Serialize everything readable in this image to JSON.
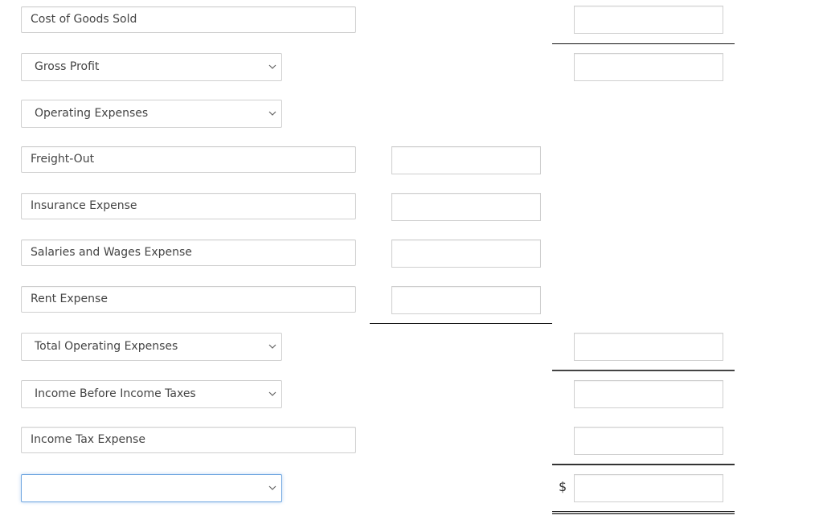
{
  "rows": [
    {
      "label": "Cost of Goods Sold",
      "type": "text"
    },
    {
      "label": "Gross Profit",
      "type": "select"
    },
    {
      "label": "Operating Expenses",
      "type": "select"
    },
    {
      "label": "Freight-Out",
      "type": "text"
    },
    {
      "label": "Insurance Expense",
      "type": "text"
    },
    {
      "label": "Salaries and Wages Expense",
      "type": "text"
    },
    {
      "label": "Rent Expense",
      "type": "text"
    },
    {
      "label": "Total Operating Expenses",
      "type": "select"
    },
    {
      "label": "Income Before Income Taxes",
      "type": "select"
    },
    {
      "label": "Income Tax Expense",
      "type": "text"
    },
    {
      "label": "",
      "type": "select"
    }
  ],
  "currency_symbol": "$",
  "icons": {
    "dropdown": "chevron-down-icon"
  },
  "colors": {
    "focus_border": "#6fa6e0",
    "input_border": "#cfcfcf"
  }
}
